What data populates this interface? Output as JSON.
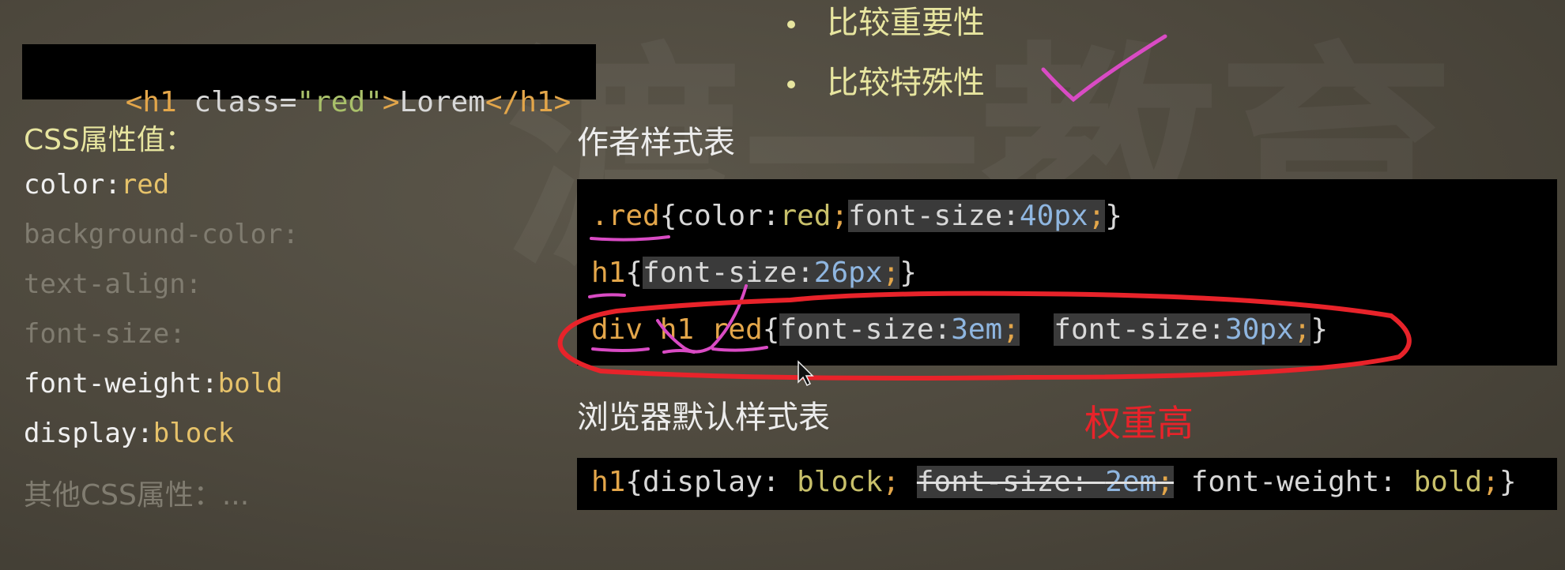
{
  "code_box": {
    "tag_open": "<h1",
    "class_attr": " class=",
    "class_value": "\"red\"",
    "gt": ">",
    "content": "Lorem",
    "tag_close": "</h1>"
  },
  "left": {
    "title": "CSS属性值：",
    "properties": [
      {
        "name": "color:",
        "value": "red"
      },
      {
        "name": "background-color:",
        "value": ""
      },
      {
        "name": "text-align:",
        "value": ""
      },
      {
        "name": "font-size:",
        "value": ""
      },
      {
        "name": "font-weight:",
        "value": "bold"
      },
      {
        "name": "display:",
        "value": "block"
      }
    ],
    "other": "其他CSS属性：..."
  },
  "bullets": [
    "比较重要性",
    "比较特殊性"
  ],
  "author_title": "作者样式表",
  "author_rules": {
    "r1": {
      "sel": ".red",
      "open": "{",
      "p1": "color:",
      "v1": "red",
      "semi1": ";",
      "p2": "font-size:",
      "v2": "40px",
      "semi2": ";",
      "close": "}"
    },
    "r2": {
      "sel": "h1",
      "open": "{",
      "p1": "font-size:",
      "v1": "26px",
      "semi1": ";",
      "close": "}"
    },
    "r3": {
      "sel": "div h1 red",
      "open": "{",
      "p1": "font-size:",
      "v1": "3em",
      "semi1": ";",
      "p2": "font-size:",
      "v2": "30px",
      "semi2": ";",
      "close": "}"
    }
  },
  "browser_title": "浏览器默认样式表",
  "weight_note": "权重高",
  "browser_rule": {
    "sel": "h1",
    "open": "{",
    "p1": "display: ",
    "v1": "block",
    "semi1": ";",
    "p2": "font-size: ",
    "v2": "2em",
    "semi2": ";",
    "p3": "font-weight: ",
    "v3": "bold",
    "semi3": ";",
    "close": "}"
  },
  "colors": {
    "annotation_pink": "#d94bc4",
    "annotation_red": "#e8232a",
    "accent_yellow": "#e7e59f"
  }
}
